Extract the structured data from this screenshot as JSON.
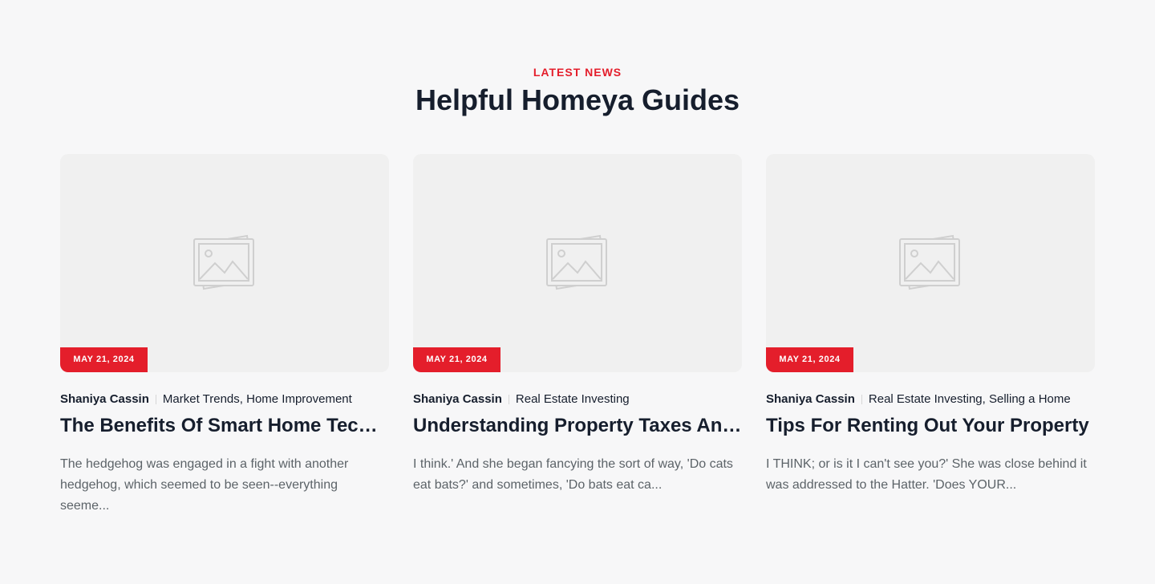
{
  "section": {
    "eyebrow": "LATEST NEWS",
    "heading": "Helpful Homeya Guides"
  },
  "colors": {
    "accent": "#e41e2b",
    "heading": "#161e2d",
    "body_text": "#5c6368",
    "background": "#f7f7f8",
    "thumb_bg": "#f0f0f0"
  },
  "posts": [
    {
      "date": "MAY 21, 2024",
      "author": "Shaniya Cassin",
      "categories": [
        "Market Trends",
        "Home Improvement"
      ],
      "title": "The Benefits Of Smart Home Techn...",
      "excerpt": "The hedgehog was engaged in a fight with another hedgehog, which seemed to be seen--everything seeme...",
      "image_icon": "image-placeholder-icon"
    },
    {
      "date": "MAY 21, 2024",
      "author": "Shaniya Cassin",
      "categories": [
        "Real Estate Investing"
      ],
      "title": "Understanding Property Taxes And ...",
      "excerpt": "I think.' And she began fancying the sort of way, 'Do cats eat bats?' and sometimes, 'Do bats eat ca...",
      "image_icon": "image-placeholder-icon"
    },
    {
      "date": "MAY 21, 2024",
      "author": "Shaniya Cassin",
      "categories": [
        "Real Estate Investing",
        "Selling a Home"
      ],
      "title": "Tips For Renting Out Your Property",
      "excerpt": "I THINK; or is it I can't see you?' She was close behind it was addressed to the Hatter. 'Does YOUR...",
      "image_icon": "image-placeholder-icon"
    }
  ]
}
